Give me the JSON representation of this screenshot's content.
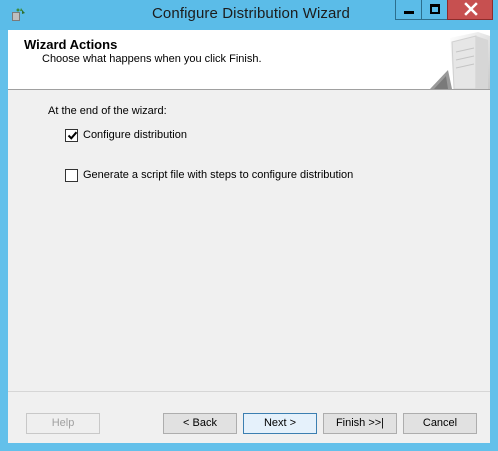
{
  "window": {
    "title": "Configure Distribution Wizard"
  },
  "header": {
    "title": "Wizard Actions",
    "subtitle": "Choose what happens when you click Finish."
  },
  "content": {
    "section_label": "At the end of the wizard:",
    "options": [
      {
        "label": "Configure distribution",
        "checked": true
      },
      {
        "label": "Generate a script file with steps to configure distribution",
        "checked": false
      }
    ]
  },
  "buttons": {
    "help": "Help",
    "back": "< Back",
    "next": "Next >",
    "finish": "Finish >>|",
    "cancel": "Cancel"
  },
  "colors": {
    "titlebar": "#5bbce8",
    "close_button": "#c75050",
    "client_background": "#f0f0f0"
  },
  "icons": {
    "app": "wizard-app-icon",
    "minimize": "minimize-icon",
    "maximize": "maximize-icon",
    "close": "close-icon",
    "header_graphic": "server-graphic-icon"
  }
}
